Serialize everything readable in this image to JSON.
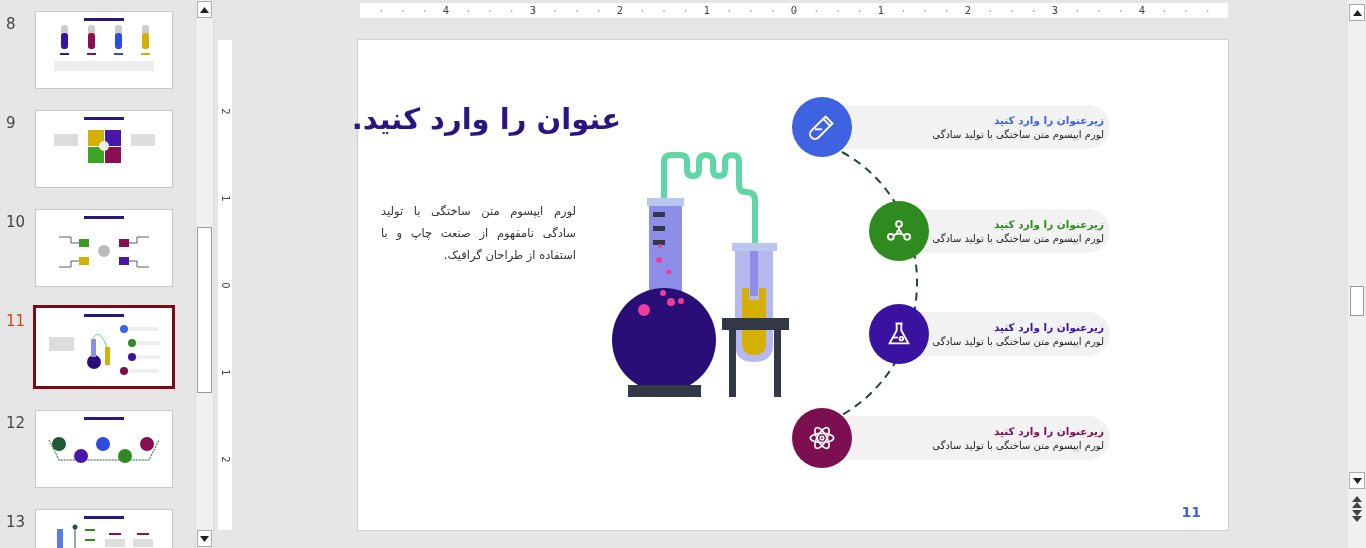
{
  "slides": [
    {
      "number": "8",
      "selected": false,
      "kind": "tubes"
    },
    {
      "number": "9",
      "selected": false,
      "kind": "grid"
    },
    {
      "number": "10",
      "selected": false,
      "kind": "microscope"
    },
    {
      "number": "11",
      "selected": true,
      "kind": "lab"
    },
    {
      "number": "12",
      "selected": false,
      "kind": "hexagons"
    },
    {
      "number": "13",
      "selected": false,
      "kind": "thermo"
    }
  ],
  "ruler_horizontal": [
    "4",
    "3",
    "2",
    "1",
    "0",
    "1",
    "2",
    "3",
    "4"
  ],
  "ruler_vertical": [
    "2",
    "1",
    "0",
    "1",
    "2"
  ],
  "slide": {
    "title": "عنوان را وارد کنید.",
    "body": "لورم ایپسوم متن ساختگی با تولید سادگی نامفهوم از صنعت چاپ و با استفاده از طراحان گرافیک.",
    "items": [
      {
        "subtitle": "زیرعنوان را وارد کنید",
        "text": "لورم ایپسوم متن ساختگی با تولید سادگی",
        "color": "#3f63e0"
      },
      {
        "subtitle": "زیرعنوان را وارد کنید",
        "text": "لورم ایپسوم متن ساختگی با تولید سادگی",
        "color": "#2f8a20"
      },
      {
        "subtitle": "زیرعنوان را وارد کنید",
        "text": "لورم ایپسوم متن ساختگی با تولید سادگی",
        "color": "#3a12a0"
      },
      {
        "subtitle": "زیرعنوان را وارد کنید",
        "text": "لورم ایپسوم متن ساختگی با تولید سادگی",
        "color": "#7c0f50"
      }
    ],
    "page_number": "11"
  }
}
